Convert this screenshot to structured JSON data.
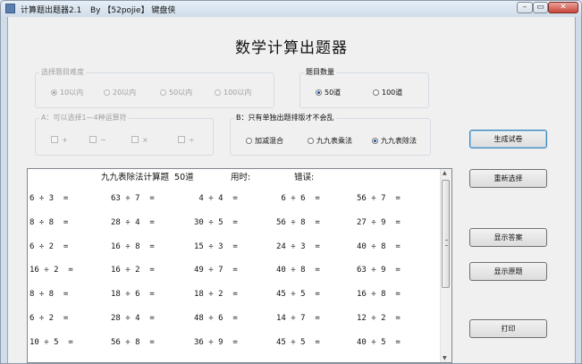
{
  "window": {
    "title": "计算题出题器2.1",
    "byline": "By 【52pojie】 键盘侠",
    "minimize_glyph": "–",
    "maximize_glyph": "▭",
    "close_glyph": "✕"
  },
  "app_title": "数学计算出题器",
  "difficulty": {
    "label": "选择题目难度",
    "options": [
      "10以内",
      "20以内",
      "50以内",
      "100以内"
    ],
    "selected": "10以内",
    "enabled": false
  },
  "count": {
    "label": "题目数量",
    "options": [
      "50道",
      "100道"
    ],
    "selected": "50道"
  },
  "operators": {
    "label": "A：可以选择1—4种运算符",
    "options": [
      "+",
      "−",
      "×",
      "÷"
    ],
    "enabled": false
  },
  "mode": {
    "label": "B：只有单独出题排版才不会乱",
    "options": [
      "加减混合",
      "九九表乘法",
      "九九表除法"
    ],
    "selected": "九九表除法"
  },
  "buttons": {
    "generate": "生成试卷",
    "reset": "重新选择",
    "show_answers": "显示答案",
    "show_original": "显示原题",
    "print": "打印"
  },
  "paper": {
    "header_title": "九九表除法计算题  50道",
    "time_label": "用时:",
    "errors_label": "错误:",
    "rows": [
      [
        "6 ÷ 3  =",
        "63 ÷ 7  =",
        " 4 ÷ 4  =",
        " 6 ÷ 6  =",
        "56 ÷ 7  ="
      ],
      [
        "8 ÷ 8  =",
        "28 ÷ 4  =",
        "30 ÷ 5  =",
        "56 ÷ 8  =",
        "27 ÷ 9  ="
      ],
      [
        "6 ÷ 2  =",
        "16 ÷ 8  =",
        "15 ÷ 3  =",
        "24 ÷ 3  =",
        "40 ÷ 8  ="
      ],
      [
        "16 ÷ 2  =",
        "16 ÷ 2  =",
        "49 ÷ 7  =",
        "40 ÷ 8  =",
        "63 ÷ 9  ="
      ],
      [
        "8 ÷ 8  =",
        "18 ÷ 6  =",
        "18 ÷ 2  =",
        "45 ÷ 5  =",
        "16 ÷ 8  ="
      ],
      [
        "6 ÷ 2  =",
        "28 ÷ 4  =",
        "48 ÷ 6  =",
        "14 ÷ 7  =",
        "12 ÷ 2  ="
      ],
      [
        "10 ÷ 5  =",
        "56 ÷ 8  =",
        "36 ÷ 9  =",
        "45 ÷ 5  =",
        "40 ÷ 5  ="
      ]
    ]
  },
  "scrollbar": {
    "up_arrow": "▲",
    "down_arrow": "▼"
  }
}
